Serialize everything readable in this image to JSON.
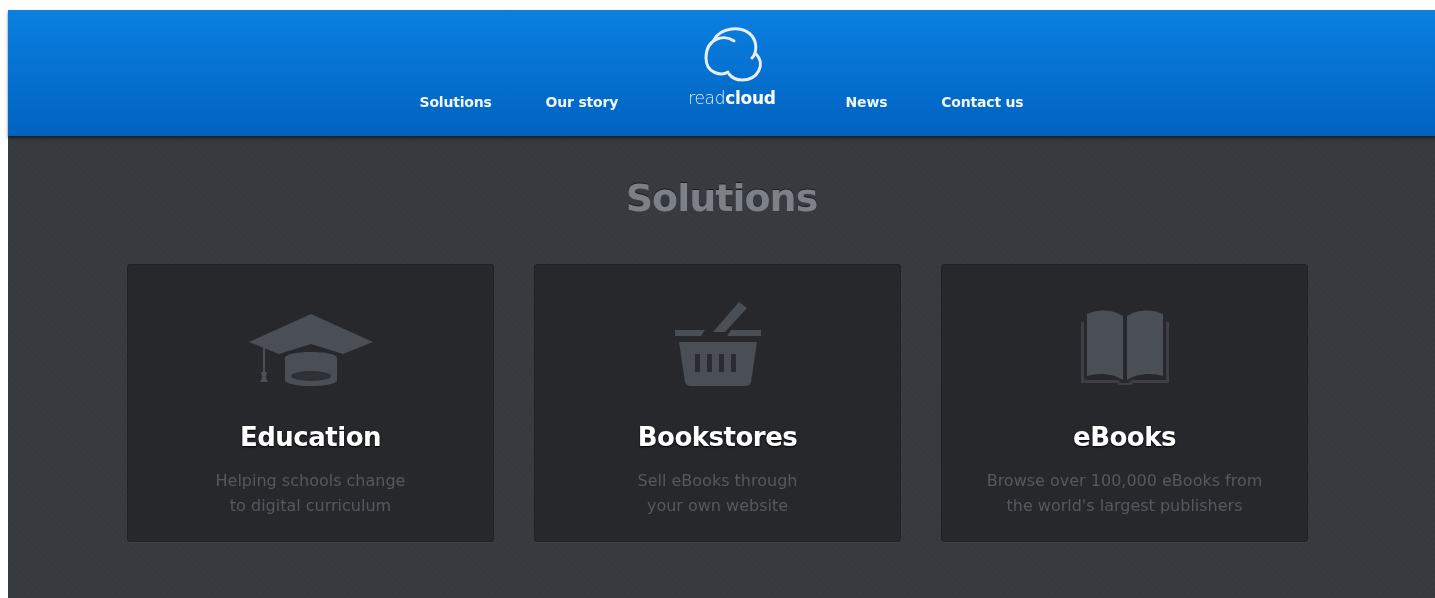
{
  "header": {
    "nav_left": [
      "Solutions",
      "Our story"
    ],
    "logo": "read**cloud**",
    "nav_right": [
      "News",
      "Contact us"
    ]
  },
  "section": {
    "title": "Solutions",
    "cards": [
      {
        "kind": "cap",
        "title": "Education",
        "lines": [
          "Helping schools change",
          "to digital curriculum"
        ]
      },
      {
        "kind": "basket",
        "title": "Bookstores",
        "lines": [
          "Sell eBooks through",
          "your own website"
        ]
      },
      {
        "kind": "book",
        "title": "eBooks",
        "lines": [
          "Browse over 100,000 eBooks from",
          "the world's largest publishers"
        ]
      }
    ]
  }
}
